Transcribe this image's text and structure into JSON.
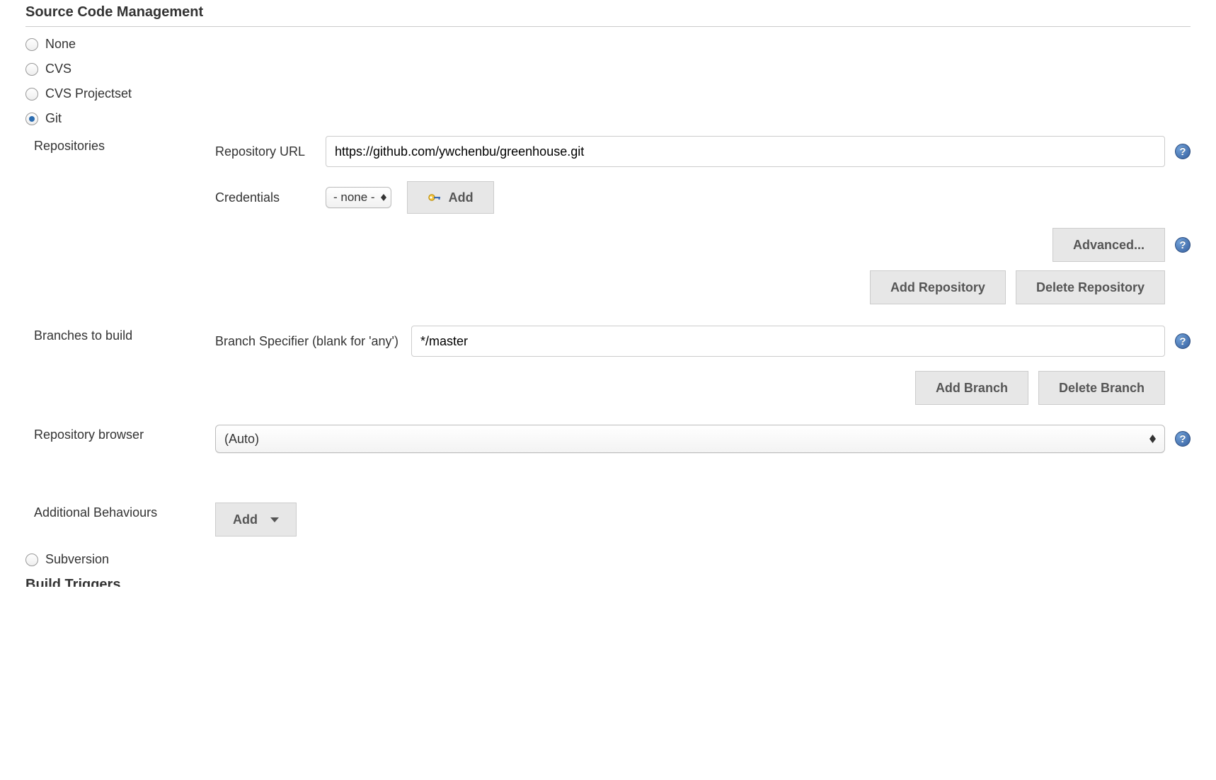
{
  "section_title": "Source Code Management",
  "scm_options": {
    "none": "None",
    "cvs": "CVS",
    "cvs_projectset": "CVS Projectset",
    "git": "Git",
    "subversion": "Subversion"
  },
  "git": {
    "repositories_label": "Repositories",
    "repo_url_label": "Repository URL",
    "repo_url_value": "https://github.com/ywchenbu/greenhouse.git",
    "credentials_label": "Credentials",
    "credentials_value": "- none -",
    "add_cred_label": "Add",
    "advanced_label": "Advanced...",
    "add_repo_label": "Add Repository",
    "delete_repo_label": "Delete Repository",
    "branches_label": "Branches to build",
    "branch_specifier_label": "Branch Specifier (blank for 'any')",
    "branch_specifier_value": "*/master",
    "add_branch_label": "Add Branch",
    "delete_branch_label": "Delete Branch",
    "repo_browser_label": "Repository browser",
    "repo_browser_value": "(Auto)",
    "additional_behaviours_label": "Additional Behaviours",
    "additional_add_label": "Add"
  },
  "next_section_partial": "Build Triggers"
}
